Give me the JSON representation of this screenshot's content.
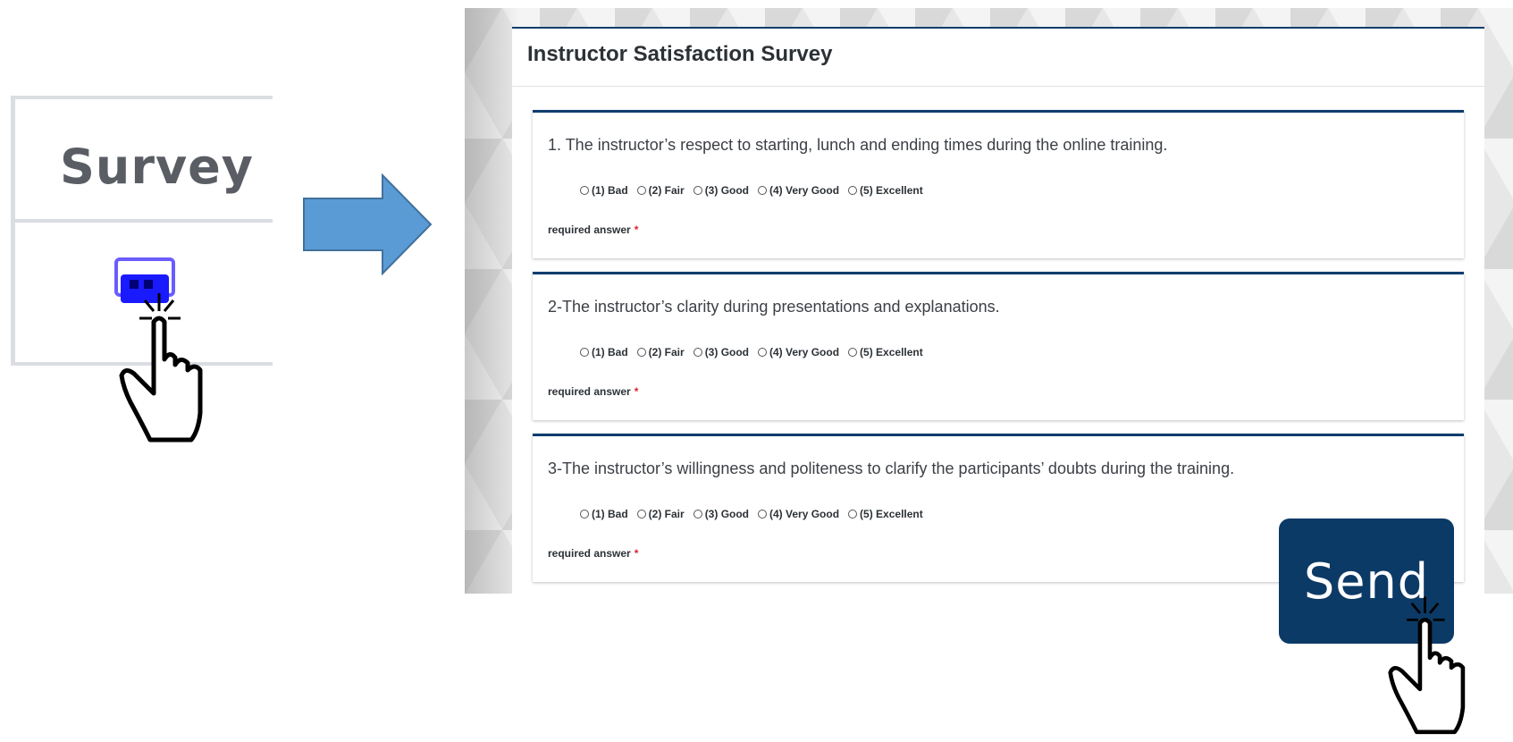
{
  "zoom": {
    "title": "Survey",
    "icon": "survey-chat-icon"
  },
  "survey": {
    "title": "Instructor Satisfaction Survey",
    "required_label": "required answer",
    "required_mark": "*",
    "options": [
      "(1) Bad",
      "(2) Fair",
      "(3) Good",
      "(4) Very Good",
      "(5) Excellent"
    ],
    "questions": [
      "1. The instructor’s respect to starting, lunch and ending times during the online training.",
      "2-The instructor’s clarity during presentations and explanations.",
      "3-The instructor’s willingness and politeness to clarify the participants’ doubts during the training."
    ]
  },
  "send_button": {
    "label": "Send"
  },
  "colors": {
    "brand_navy": "#0c3a66",
    "arrow_blue": "#5b9bd5",
    "required_red": "#d8262c"
  }
}
